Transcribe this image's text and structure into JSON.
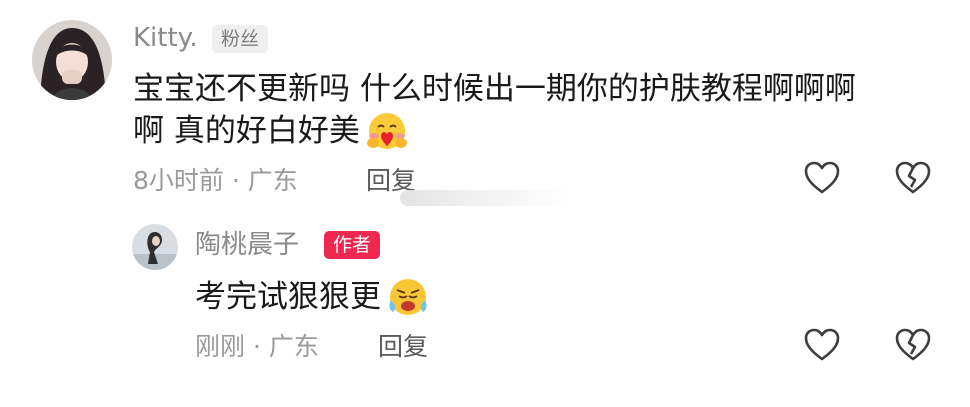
{
  "comments": [
    {
      "username": "Kitty.",
      "badge": "粉丝",
      "text_line1": "宝宝还不更新吗 什么时候出一期你的护肤教程啊啊啊",
      "text_line2": "啊 真的好白好美",
      "emoji": "hugging-heart-emoji",
      "time_location": "8小时前 · 广东",
      "reply_label": "回复",
      "like_icon": "heart-outline-icon",
      "dislike_icon": "broken-heart-icon"
    },
    {
      "username": "陶桃晨子",
      "badge": "作者",
      "text": "考完试狠狠更",
      "emoji": "crying-face-emoji",
      "time_location": "刚刚 · 广东",
      "reply_label": "回复",
      "like_icon": "heart-outline-icon",
      "dislike_icon": "broken-heart-icon"
    }
  ],
  "colors": {
    "author_badge": "#f0284f",
    "fan_badge_bg": "#efefef",
    "username": "#8a8a8a",
    "text": "#1a1a1a",
    "meta": "#9a9a9a"
  }
}
